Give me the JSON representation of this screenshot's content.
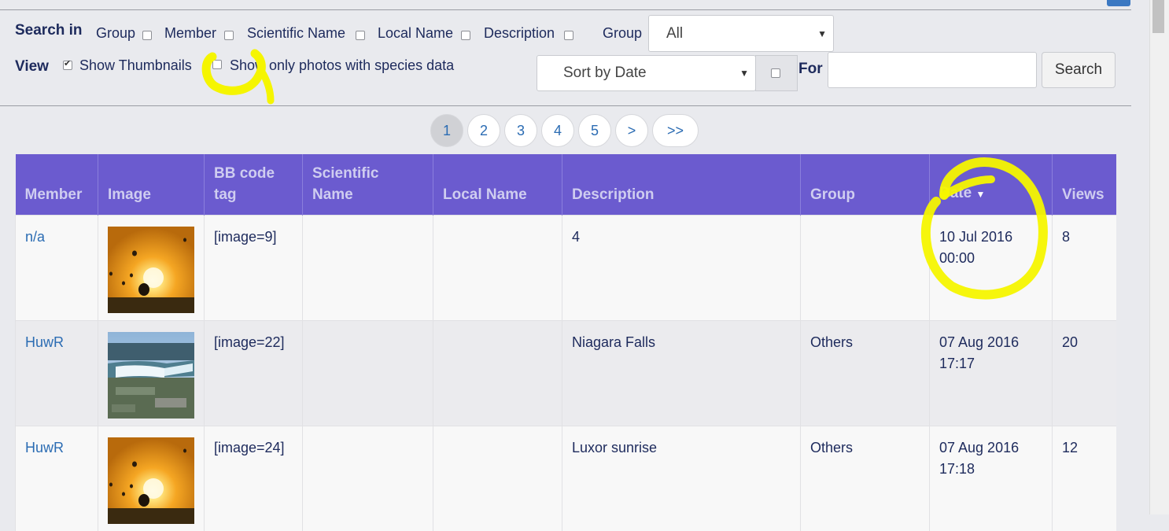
{
  "search": {
    "label": "Search in",
    "options": [
      {
        "label": "Group",
        "checked": false
      },
      {
        "label": "Member",
        "checked": false
      },
      {
        "label": "Scientific Name",
        "checked": false
      },
      {
        "label": "Local Name",
        "checked": false
      },
      {
        "label": "Description",
        "checked": false
      }
    ],
    "group_label": "Group",
    "group_value": "All"
  },
  "view": {
    "label": "View",
    "show_thumbnails": "Show Thumbnails",
    "show_thumbnails_checked": true,
    "species_only": "Show only photos with species data",
    "species_only_checked": false
  },
  "sort": {
    "value": "Sort by Date",
    "descending_checked": false,
    "for_label": "For",
    "query": "",
    "search_button": "Search"
  },
  "pagination": {
    "pages": [
      "1",
      "2",
      "3",
      "4",
      "5",
      ">",
      ">>"
    ],
    "active": "1"
  },
  "table": {
    "headers": {
      "member": "Member",
      "image": "Image",
      "bbcode": "BB code tag",
      "scientific": "Scientific Name",
      "local": "Local Name",
      "description": "Description",
      "group": "Group",
      "date": "Date",
      "views": "Views"
    },
    "rows": [
      {
        "member": "n/a",
        "image_icon": "hot-air-balloons-sunset-image",
        "bbcode": "[image=9]",
        "scientific": "",
        "local": "",
        "description": "4",
        "group": "",
        "date": "10 Jul 2016",
        "time": "00:00",
        "views": "8"
      },
      {
        "member": "HuwR",
        "image_icon": "niagara-falls-image",
        "bbcode": "[image=22]",
        "scientific": "",
        "local": "",
        "description": "Niagara Falls",
        "group": "Others",
        "date": "07 Aug 2016",
        "time": "17:17",
        "views": "20"
      },
      {
        "member": "HuwR",
        "image_icon": "hot-air-balloons-sunset-image",
        "bbcode": "[image=24]",
        "scientific": "",
        "local": "",
        "description": "Luxor sunrise",
        "group": "Others",
        "date": "07 Aug 2016",
        "time": "17:18",
        "views": "12"
      }
    ]
  },
  "colors": {
    "header_bg": "#6b5bcf",
    "link": "#2b6cb3",
    "highlight": "#f5f500"
  }
}
